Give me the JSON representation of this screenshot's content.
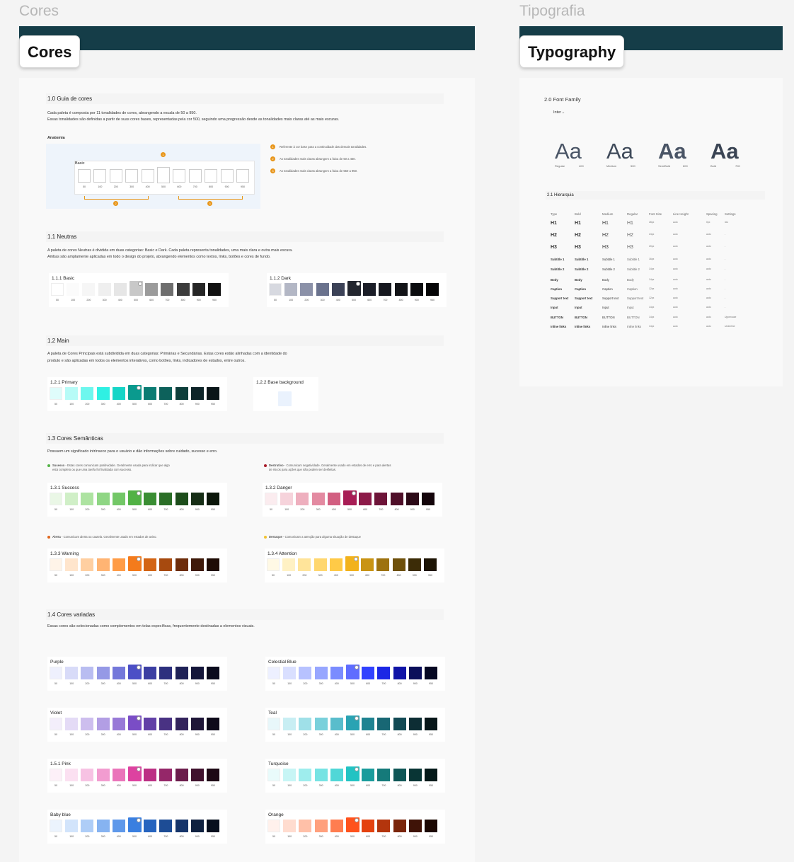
{
  "frames": {
    "cores_title": "Cores",
    "tipografia_title": "Tipografia",
    "cores_tag": "Cores",
    "typography_tag": "Typography"
  },
  "guide": {
    "title": "1.0 Guia de cores",
    "desc1": "Cada paleta é composta por 11 tonalidades de cores, abrangendo a escala de 50 a 950.",
    "desc2": "Essas tonalidades são definidas a partir de suas cores bases, representadas pela cor 500, seguindo uma progressão desde as tonalidades mais claras até as mais escuras.",
    "anatomy_label": "Anatomia",
    "anatomy_card_label": "Basic",
    "notes": [
      "Referente à cor base para a continuidade das demais tonalidades.",
      "As tonalidades mais claras abrangem a faixa de 50 a 450.",
      "As tonalidades mais claras abrangem a faixa de 550 a 950."
    ],
    "badges": [
      "1",
      "2",
      "3"
    ]
  },
  "scale": [
    "50",
    "100",
    "200",
    "300",
    "400",
    "500",
    "600",
    "700",
    "800",
    "900",
    "950"
  ],
  "neutras": {
    "title": "1.1 Neutras",
    "desc1": "A paleta de cores Neutras é dividida em duas categorias: Basic e Dark. Cada paleta representa tonalidades, uma mais clara e outra mais escura.",
    "desc2": "Ambas são amplamente aplicadas em todo o design do projeto, abrangendo elementos como textos, links, botões e cores de fundo.",
    "basic_label": "1.1.1 Basic",
    "dark_label": "1.1.2 Dark"
  },
  "main": {
    "title": "1.2 Main",
    "desc1": "A paleta de Cores Principais está subdividida em duas categorias: Primárias e Secundárias. Estas cores estão alinhadas com a identidade do",
    "desc2": "produto e são aplicadas em todos os elementos interativos, como botões, links, indicadores de estados, entre outros.",
    "primary_label": "1.2.1 Primary",
    "base_bg_label": "1.2.2 Base background"
  },
  "semanticas": {
    "title": "1.3 Cores Semânticas",
    "desc": "Possuem um significado intrínseco para o usuário e dão informações sobre cuidado, sucesso e erro.",
    "success_note_title": "Sucesso",
    "success_note": " - Estas cores comunicam positividade. Geralmente usada para indicar que algo",
    "success_note2": "está completo ou que uma tarefa foi finalizada com sucesso.",
    "danger_note_title": "Destrutivo",
    "danger_note": " - Comunicam negatividade. Geralmente usado em estados de erro e para alertas",
    "danger_note2": "de riscos para ações que não podem ser desfeitas.",
    "warning_note_title": "Alerta",
    "warning_note": " - Comunicam alerta ou cautela. Geralmente usado em estados de aviso.",
    "attention_note_title": "Destaque",
    "attention_note": " - Comunicam a atenção para alguma situação de destaque",
    "success_label": "1.3.1 Success",
    "danger_label": "1.3.2 Danger",
    "warning_label": "1.3.3 Warning",
    "attention_label": "1.3.4 Attention"
  },
  "variadas": {
    "title": "1.4 Cores variadas",
    "desc": "Essas cores são selecionadas como complementos em telas específicas, frequentemente destinadas a elementos visuais.",
    "purple": "Purple",
    "celestial": "Celestial Blue",
    "violet": "Violet",
    "teal": "Teal",
    "pink": "1.5.1 Pink",
    "turquoise": "Turquoise",
    "babyblue": "Baby blue",
    "orange": "Orange"
  },
  "palettes": {
    "basic": [
      "#ffffff",
      "#fbfbfb",
      "#f6f6f6",
      "#efefef",
      "#e6e6e6",
      "#c8c8c8",
      "#9b9b9b",
      "#6e6e6e",
      "#3c3c3c",
      "#262626",
      "#111111"
    ],
    "dark": [
      "#d7d9e0",
      "#b3b7c5",
      "#8b91a8",
      "#6a728d",
      "#3c4257",
      "#23262f",
      "#1b1e28",
      "#16181f",
      "#121317",
      "#0b0c0f",
      "#050506"
    ],
    "primary": [
      "#dffcfb",
      "#b7fbf7",
      "#6ef7ee",
      "#2ff0e3",
      "#16d5c7",
      "#0a9a8e",
      "#0b7c73",
      "#0d615b",
      "#0e3e3b",
      "#0d2428",
      "#0a1518"
    ],
    "success": [
      "#eaf7e6",
      "#d0efc7",
      "#ade3a1",
      "#8fd684",
      "#73c767",
      "#52b245",
      "#3a8e33",
      "#2b6e27",
      "#1d4d1b",
      "#172e16",
      "#0c170b"
    ],
    "danger": [
      "#fbecef",
      "#f6d3db",
      "#eeafbe",
      "#e38aa1",
      "#d25f81",
      "#a81d55",
      "#8c1a48",
      "#6e1539",
      "#4f0f29",
      "#2c0a17",
      "#14050b"
    ],
    "warning": [
      "#fff4e8",
      "#ffe5cc",
      "#ffcfa1",
      "#ffb473",
      "#ff9c47",
      "#f47b1c",
      "#d36414",
      "#a74a0f",
      "#6d2d0b",
      "#3f1a0a",
      "#1f0c05"
    ],
    "attention": [
      "#fff9e5",
      "#fff1c4",
      "#ffe49a",
      "#ffd76f",
      "#ffca47",
      "#f2b21c",
      "#c99414",
      "#9d720f",
      "#6e500b",
      "#3c2c07",
      "#1d1404"
    ],
    "purple": [
      "#eef0fd",
      "#d8dbf8",
      "#b9bdf1",
      "#9599e6",
      "#7478da",
      "#4c4fc6",
      "#3b3ea3",
      "#2d307e",
      "#1f2257",
      "#14163a",
      "#0a0b1d"
    ],
    "celestial": [
      "#edf0ff",
      "#d9dfff",
      "#b7c2ff",
      "#97a6ff",
      "#7a8cff",
      "#5f6dff",
      "#3142ff",
      "#1b27e5",
      "#1014a7",
      "#0b0f5a",
      "#060822"
    ],
    "violet": [
      "#f3eefb",
      "#e4dbf6",
      "#cdbeee",
      "#b29ee4",
      "#9879d7",
      "#7a4dc6",
      "#6240a7",
      "#493283",
      "#33235c",
      "#1f1638",
      "#0e0a1a"
    ],
    "teal": [
      "#e8f7fa",
      "#c8eef3",
      "#9fe0e8",
      "#79d0db",
      "#59bdcc",
      "#2aa3b3",
      "#1f8391",
      "#186774",
      "#124a54",
      "#0d2d34",
      "#071619"
    ],
    "pink": [
      "#fdf0f8",
      "#fbe0f1",
      "#f7c2e3",
      "#f29cd0",
      "#ea74ba",
      "#dd42a0",
      "#bc2f84",
      "#952769",
      "#6c1d4c",
      "#40112d",
      "#1e0815"
    ],
    "turquoise": [
      "#e9fbfb",
      "#c7f5f5",
      "#9eeded",
      "#76e3e3",
      "#50d7d7",
      "#22c3c3",
      "#1a9c9c",
      "#157a7a",
      "#0f5656",
      "#093535",
      "#041919"
    ],
    "babyblue": [
      "#ebf3fd",
      "#d2e4fb",
      "#aecdf7",
      "#86b3f1",
      "#5e98ea",
      "#3a7fe0",
      "#2664bf",
      "#1d4c95",
      "#16356a",
      "#0f2140",
      "#070f1e"
    ],
    "orange": [
      "#fff1ec",
      "#ffdccf",
      "#ffc0a8",
      "#ffa07d",
      "#ff7d50",
      "#ff521c",
      "#e4420f",
      "#b3350d",
      "#7a250b",
      "#3f1307",
      "#1c0803"
    ],
    "base_bg": "#eaf2fd"
  },
  "typography": {
    "family_title": "2.0 Font Family",
    "font_name": "Inter",
    "aa": [
      "Aa",
      "Aa",
      "Aa",
      "Aa"
    ],
    "weights": [
      {
        "name": "Regular",
        "val": "400"
      },
      {
        "name": "Medium",
        "val": "500"
      },
      {
        "name": "SemiBold",
        "val": "600"
      },
      {
        "name": "Bold",
        "val": "700"
      }
    ],
    "hier_title": "2.1 Hierarquia",
    "headers": [
      "Type",
      "Bold",
      "Medium",
      "Regular",
      "Font Size",
      "Line Height",
      "Spacing",
      "Settings"
    ],
    "rows": [
      {
        "type": "H1",
        "bold": "H1",
        "medium": "H1",
        "regular": "H1",
        "size": "28px",
        "lh": "auto",
        "sp": "0px",
        "set": "ixis"
      },
      {
        "type": "H2",
        "bold": "H2",
        "medium": "H2",
        "regular": "H2",
        "size": "24px",
        "lh": "auto",
        "sp": "auto",
        "set": "-"
      },
      {
        "type": "H3",
        "bold": "H3",
        "medium": "H3",
        "regular": "H3",
        "size": "20px",
        "lh": "auto",
        "sp": "auto",
        "set": "-"
      },
      {
        "type": "Subtitle 1",
        "bold": "Subtitle 1",
        "medium": "Subtitle 1",
        "regular": "Subtitle 1",
        "size": "16px",
        "lh": "auto",
        "sp": "auto",
        "set": "-"
      },
      {
        "type": "Subtitle 2",
        "bold": "Subtitle 2",
        "medium": "Subtitle 2",
        "regular": "Subtitle 2",
        "size": "14px",
        "lh": "auto",
        "sp": "auto",
        "set": "-"
      },
      {
        "type": "Body",
        "bold": "Body",
        "medium": "Body",
        "regular": "Body",
        "size": "14px",
        "lh": "auto",
        "sp": "auto",
        "set": "-"
      },
      {
        "type": "Caption",
        "bold": "Caption",
        "medium": "Caption",
        "regular": "Caption",
        "size": "12px",
        "lh": "auto",
        "sp": "auto",
        "set": "-"
      },
      {
        "type": "Support text",
        "bold": "Support text",
        "medium": "Support text",
        "regular": "Support text",
        "size": "12px",
        "lh": "auto",
        "sp": "auto",
        "set": "-"
      },
      {
        "type": "Input",
        "bold": "Input",
        "medium": "Input",
        "regular": "Input",
        "size": "14px",
        "lh": "auto",
        "sp": "auto",
        "set": "-"
      },
      {
        "type": "BUTTON",
        "bold": "BUTTON",
        "medium": "BUTTON",
        "regular": "BUTTON",
        "size": "14px",
        "lh": "auto",
        "sp": "auto",
        "set": "Uppercase"
      },
      {
        "type": "Inline links",
        "bold": "Inline links",
        "medium": "Inline links",
        "regular": "Inline links",
        "size": "14px",
        "lh": "auto",
        "sp": "auto",
        "set": "Underline"
      }
    ]
  }
}
